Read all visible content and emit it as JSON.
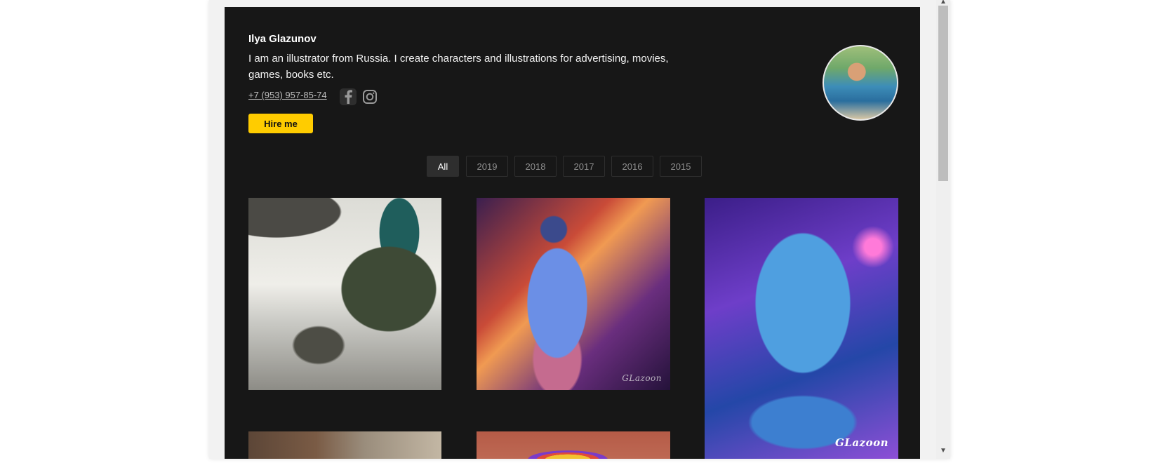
{
  "profile": {
    "name": "Ilya Glazunov",
    "bio": "I am an illustrator from Russia. I create characters and illustrations for advertising, movies, games, books etc.",
    "phone": "+7 (953) 957-85-74",
    "hire_label": "Hire me",
    "social": [
      "facebook-icon",
      "instagram-icon"
    ]
  },
  "filters": {
    "tabs": [
      "All",
      "2019",
      "2018",
      "2017",
      "2016",
      "2015"
    ],
    "active": "All"
  },
  "gallery": {
    "watermark": "GLazoon"
  },
  "colors": {
    "panel": "#171717",
    "accent": "#ffcc00",
    "tab_active": "#2e2e2e"
  }
}
